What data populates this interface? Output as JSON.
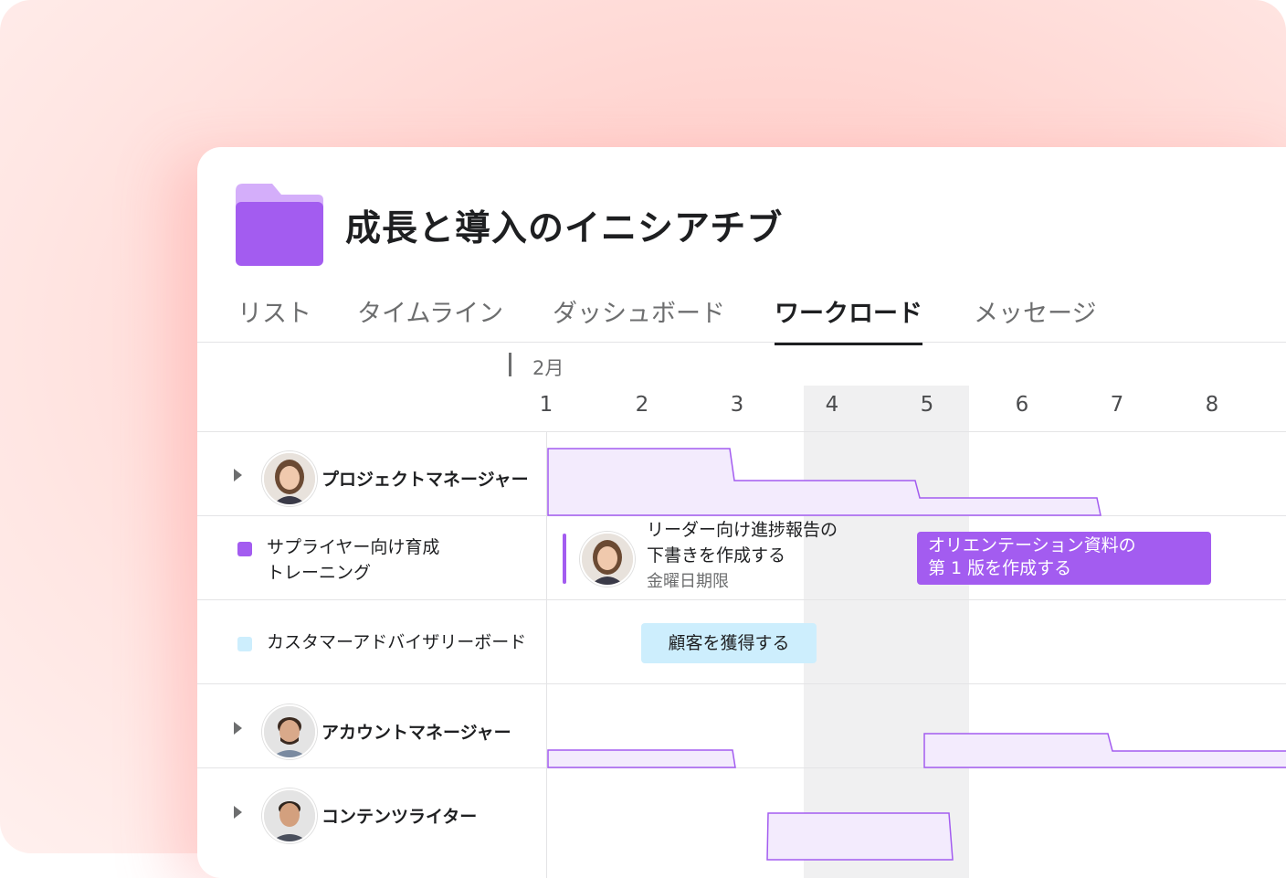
{
  "project": {
    "title": "成長と導入のイニシアチブ"
  },
  "tabs": [
    {
      "label": "リスト",
      "active": false
    },
    {
      "label": "タイムライン",
      "active": false
    },
    {
      "label": "ダッシュボード",
      "active": false
    },
    {
      "label": "ワークロード",
      "active": true
    },
    {
      "label": "メッセージ",
      "active": false
    }
  ],
  "timeline": {
    "month": "2月",
    "days": [
      "1",
      "2",
      "3",
      "4",
      "5",
      "6",
      "7",
      "8"
    ]
  },
  "rows": {
    "pm": {
      "name": "プロジェクトマネージャー"
    },
    "supplier": {
      "line1": "サプライヤー向け育成",
      "line2": "トレーニング",
      "color": "#a35cf0"
    },
    "advisory": {
      "name": "カスタマーアドバイザリーボード",
      "color": "#cdeefd"
    },
    "am": {
      "name": "アカウントマネージャー"
    },
    "writer": {
      "name": "コンテンツライター"
    }
  },
  "tasks": {
    "report": {
      "line1": "リーダー向け進捗報告の",
      "line2": "下書きを作成する",
      "due": "金曜日期限"
    },
    "orientation": {
      "line1": "オリエンテーション資料の",
      "line2": "第 1 版を作成する",
      "color": "#a35cf0"
    },
    "customer": {
      "label": "顧客を獲得する"
    }
  },
  "colors": {
    "accent": "#a35cf0",
    "workload_fill": "#f3ebfd",
    "workload_line": "#a35cf0"
  }
}
